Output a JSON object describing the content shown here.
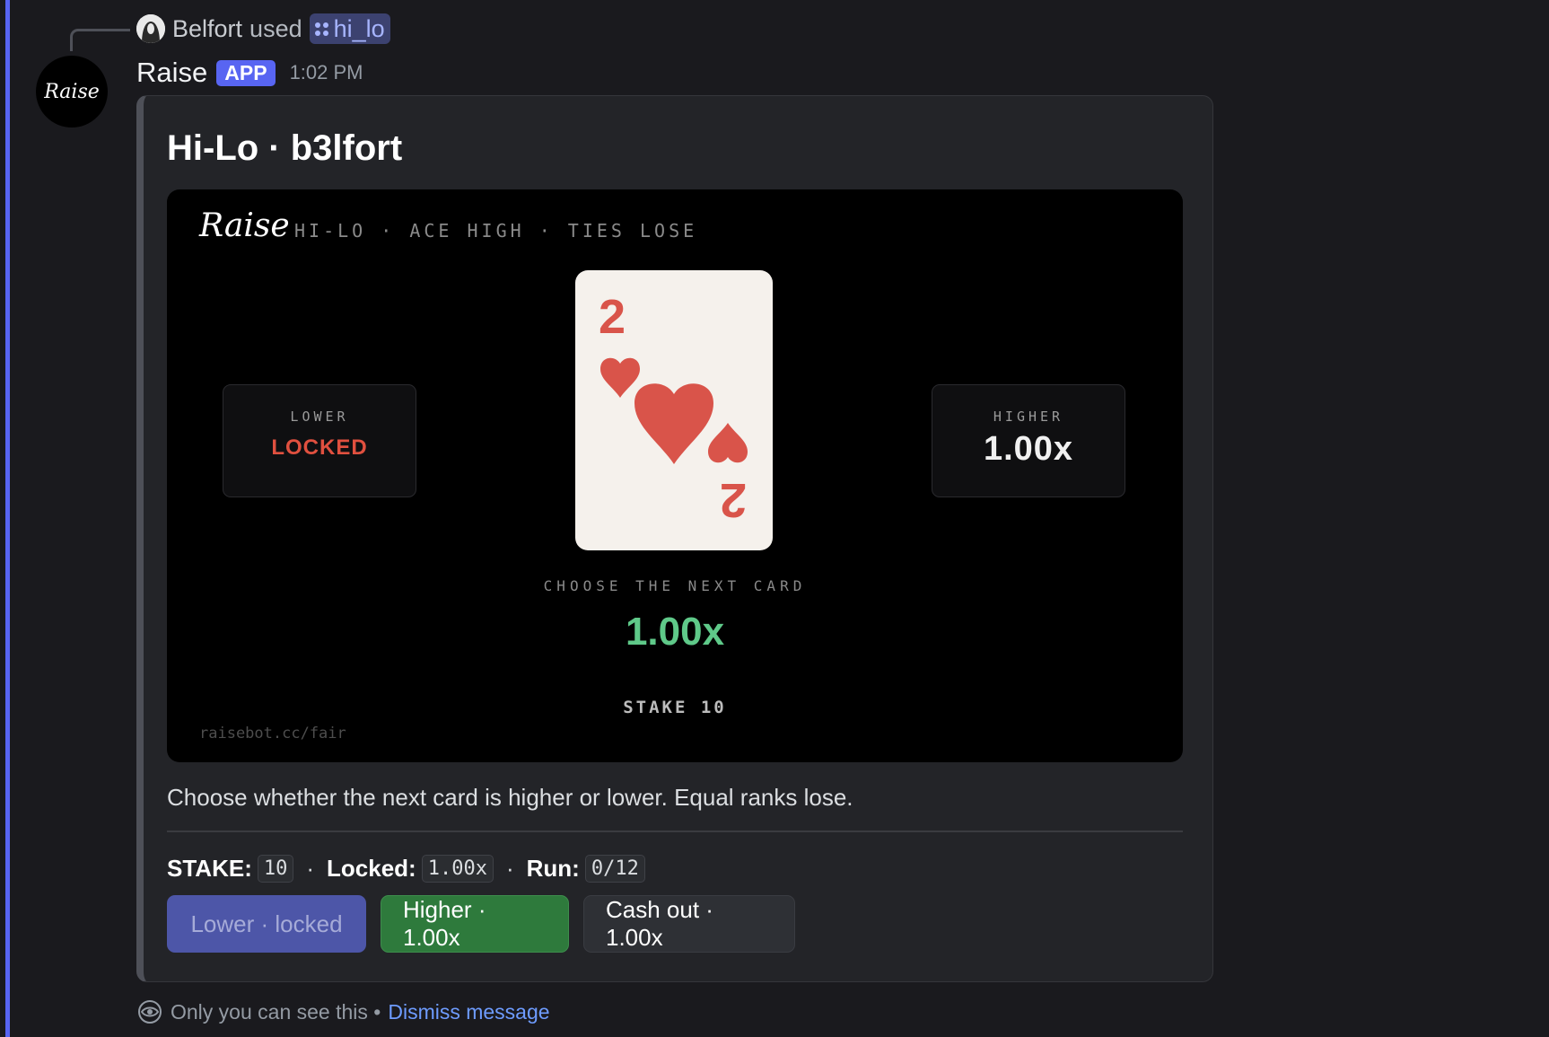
{
  "reply": {
    "user": "Belfort",
    "used_text": "used",
    "command": "hi_lo"
  },
  "message": {
    "avatar_text": "Raise",
    "bot_name": "Raise",
    "badge": "APP",
    "time": "1:02 PM"
  },
  "embed": {
    "title": "Hi-Lo · b3lfort",
    "game": {
      "logo": "Raise",
      "tagline": "HI-LO · ACE HIGH · TIES LOSE",
      "lower": {
        "label": "LOWER",
        "value": "LOCKED"
      },
      "higher": {
        "label": "HIGHER",
        "value": "1.00x"
      },
      "card": {
        "rank": "2",
        "suit": "hearts"
      },
      "choose_label": "CHOOSE THE NEXT CARD",
      "current_multiplier": "1.00x",
      "stake_label": "STAKE 10",
      "fair_link": "raisebot.cc/fair"
    },
    "description": "Choose whether the next card is higher or lower. Equal ranks lose.",
    "stats": {
      "stake_label": "STAKE:",
      "stake_value": "10",
      "locked_label": "Locked:",
      "locked_value": "1.00x",
      "run_label": "Run:",
      "run_value": "0/12",
      "separator": "·"
    },
    "buttons": {
      "lower": "Lower · locked",
      "higher": "Higher · 1.00x",
      "cash_out": "Cash out · 1.00x"
    }
  },
  "footer": {
    "text": "Only you can see this •",
    "dismiss": "Dismiss message"
  },
  "colors": {
    "accent": "#5865f2",
    "locked_red": "#e0503f",
    "multiplier_green": "#5fc989",
    "heart_red": "#d9544a",
    "higher_button": "#2e7a3c"
  }
}
